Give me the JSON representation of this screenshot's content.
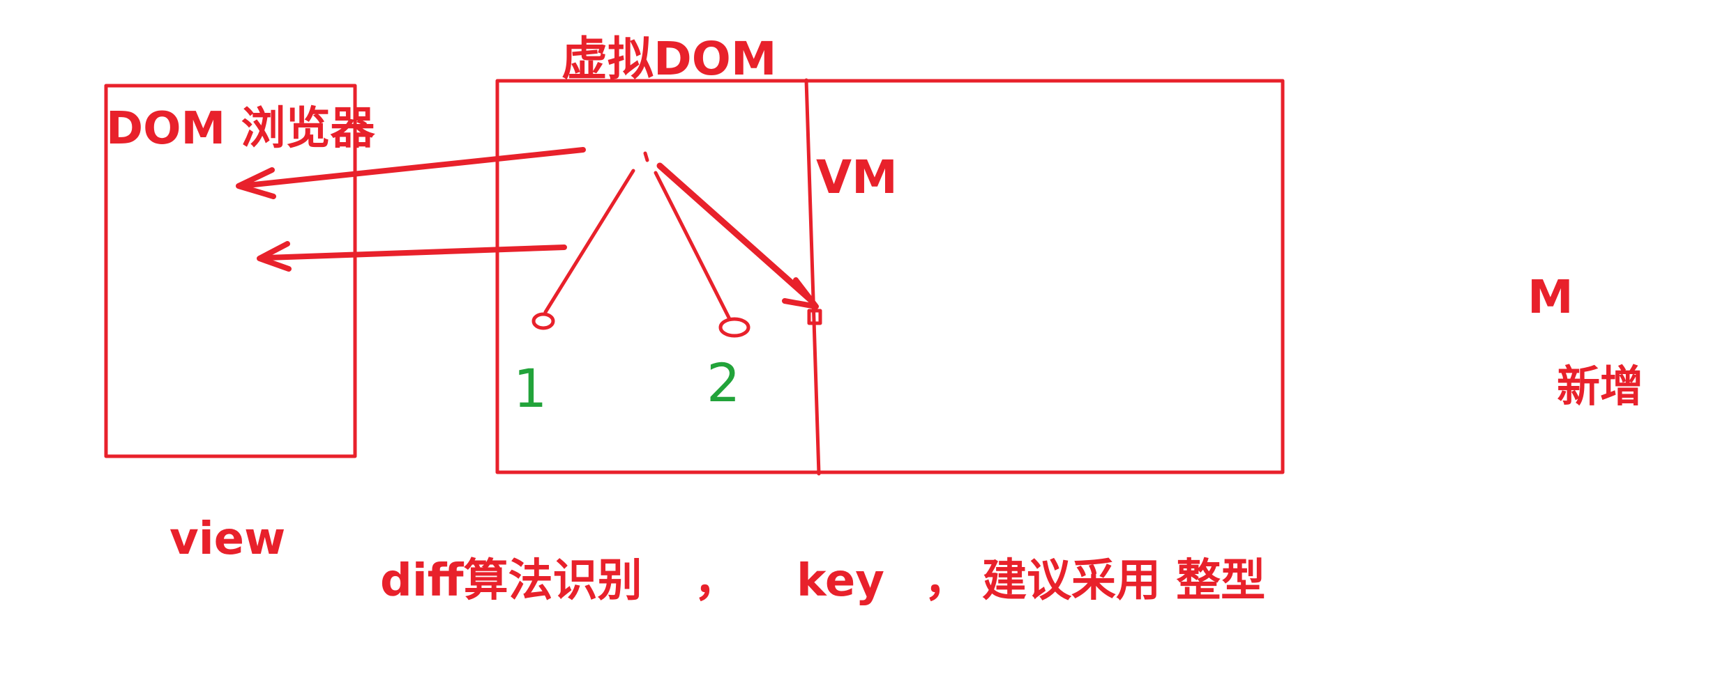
{
  "colors": {
    "ink_red": "#e8212b",
    "ink_green": "#22a33a",
    "background": "#ffffff"
  },
  "labels": {
    "dom_browser": "DOM 浏览器",
    "virtual_dom": "虚拟DOM",
    "vm": "VM",
    "m": "M",
    "added": "新增",
    "view": "view",
    "node_one": "1",
    "node_two": "2",
    "diff_part": "diff算法识别",
    "key_part": "key",
    "suggest_part": "建议采用 整型",
    "comma_one": "，",
    "comma_two": "，"
  }
}
